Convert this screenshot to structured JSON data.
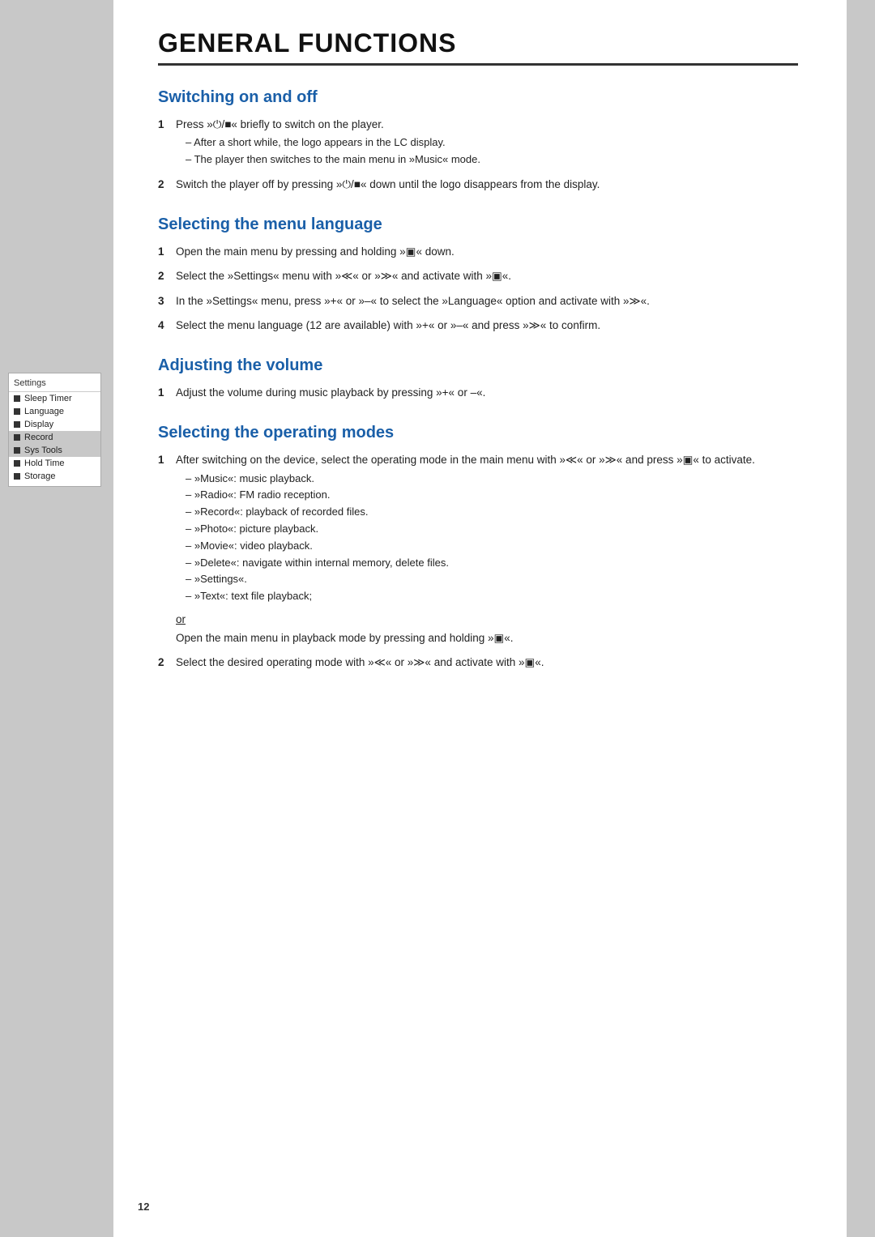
{
  "page": {
    "title": "GENERAL FUNCTIONS",
    "number": "12"
  },
  "sidebar": {
    "title": "Settings",
    "items": [
      {
        "label": "Sleep Timer",
        "active": false
      },
      {
        "label": "Language",
        "active": false
      },
      {
        "label": "Display",
        "active": false
      },
      {
        "label": "Record",
        "active": true
      },
      {
        "label": "Sys Tools",
        "active": true
      },
      {
        "label": "Hold Time",
        "active": false
      },
      {
        "label": "Storage",
        "active": false
      }
    ]
  },
  "sections": {
    "switching": {
      "title": "Switching on and off",
      "items": [
        {
          "number": "1",
          "main": "Press »⏻/■« briefly to switch on the player.",
          "subs": [
            "After a short while, the logo appears in the LC display.",
            "The player then switches to the main menu in »Music« mode."
          ]
        },
        {
          "number": "2",
          "main": "Switch the player off by pressing »⏻/■« down until the logo disappears from the display.",
          "subs": []
        }
      ]
    },
    "language": {
      "title": "Selecting the menu language",
      "items": [
        {
          "number": "1",
          "main": "Open the main menu by pressing and holding »▣« down.",
          "subs": []
        },
        {
          "number": "2",
          "main": "Select the »Settings« menu with »≪« or »≫« and activate with »▣«.",
          "subs": []
        },
        {
          "number": "3",
          "main": "In the »Settings« menu, press »+« or »–« to select the »Language« option and activate with »≫«.",
          "subs": []
        },
        {
          "number": "4",
          "main": "Select the menu language (12 are available) with »+« or »–« and press »≫« to confirm.",
          "subs": []
        }
      ]
    },
    "volume": {
      "title": "Adjusting the volume",
      "items": [
        {
          "number": "1",
          "main": "Adjust the volume during music playback by pressing »+« or –«.",
          "subs": []
        }
      ]
    },
    "operating": {
      "title": "Selecting the operating modes",
      "items": [
        {
          "number": "1",
          "main": "After switching on the device, select the operating mode in the main menu with »≪« or »≫« and press »▣« to activate.",
          "subs": [
            "»Music«: music playback.",
            "»Radio«: FM radio reception.",
            "»Record«: playback of recorded files.",
            "»Photo«: picture playback.",
            "»Movie«: video playback.",
            "»Delete«: navigate within internal memory, delete files.",
            "»Settings«.",
            "»Text«: text file playback;"
          ]
        },
        {
          "number": "2",
          "main": "Select the desired operating mode with »≪« or »≫« and activate with »▣«.",
          "subs": []
        }
      ],
      "or_label": "or",
      "or_text": "Open the main menu in playback mode by pressing and holding »▣«."
    }
  }
}
